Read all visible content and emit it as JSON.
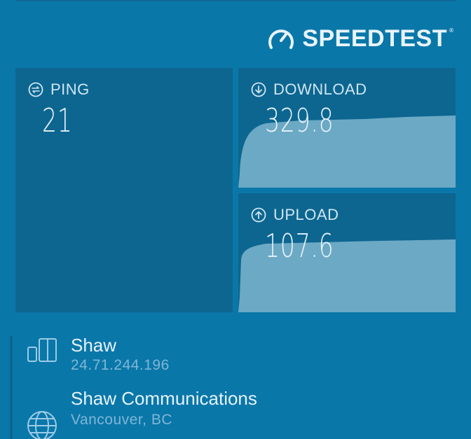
{
  "brand": {
    "name": "SPEEDTEST",
    "trademark": "®",
    "icon": "speedometer-icon"
  },
  "results": {
    "ping": {
      "label": "PING",
      "value": "21",
      "icon": "ping-icon"
    },
    "download": {
      "label": "DOWNLOAD",
      "value": "329.8",
      "icon": "download-arrow-icon"
    },
    "upload": {
      "label": "UPLOAD",
      "value": "107.6",
      "icon": "upload-arrow-icon"
    }
  },
  "isp": {
    "name": "Shaw",
    "ip": "24.71.244.196",
    "icon": "device-icon"
  },
  "server": {
    "name": "Shaw Communications",
    "location": "Vancouver, BC",
    "icon": "globe-icon"
  },
  "colors": {
    "background": "#0a77a9",
    "panel": "#0d6690",
    "graph_fill": "#6ca9c5",
    "text": "#e6f3fa"
  }
}
